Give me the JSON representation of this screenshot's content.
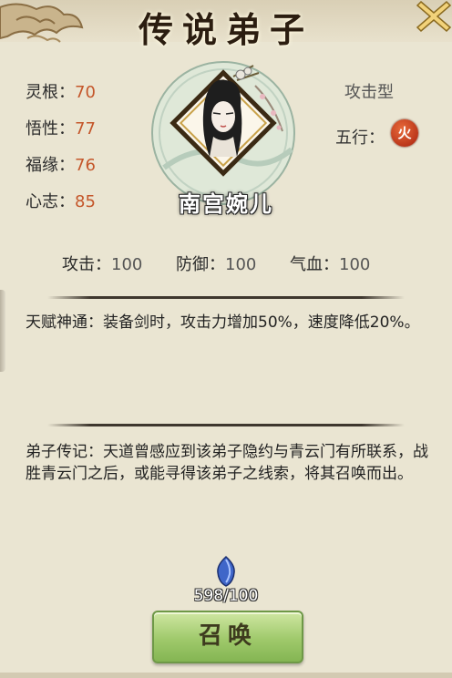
{
  "title": "传说弟子",
  "character": {
    "name": "南宫婉儿",
    "type": "攻击型"
  },
  "attributes": [
    {
      "label": "灵根：",
      "value": "70"
    },
    {
      "label": "悟性：",
      "value": "77"
    },
    {
      "label": "福缘：",
      "value": "76"
    },
    {
      "label": "心志：",
      "value": "85"
    }
  ],
  "wuxing": {
    "label": "五行：",
    "element": "火",
    "color": "#b8260f"
  },
  "combat": [
    {
      "label": "攻击：",
      "value": "100"
    },
    {
      "label": "防御：",
      "value": "100"
    },
    {
      "label": "气血：",
      "value": "100"
    }
  ],
  "talent": {
    "text": "天赋神通：装备剑时，攻击力增加50%，速度降低20%。"
  },
  "biography": {
    "text": "弟子传记：天道曾感应到该弟子隐约与青云门有所联系，战胜青云门之后，或能寻得该弟子之线索，将其召唤而出。"
  },
  "summon": {
    "count": "598/100",
    "button_label": "召唤",
    "gem_icon": "blue-crystal-icon"
  },
  "icons": {
    "close": "close-x-icon",
    "element": "fire-element-icon"
  },
  "colors": {
    "accent_value": "#c4562a",
    "button_green": "#9fc96b",
    "background": "#eae5d2"
  }
}
